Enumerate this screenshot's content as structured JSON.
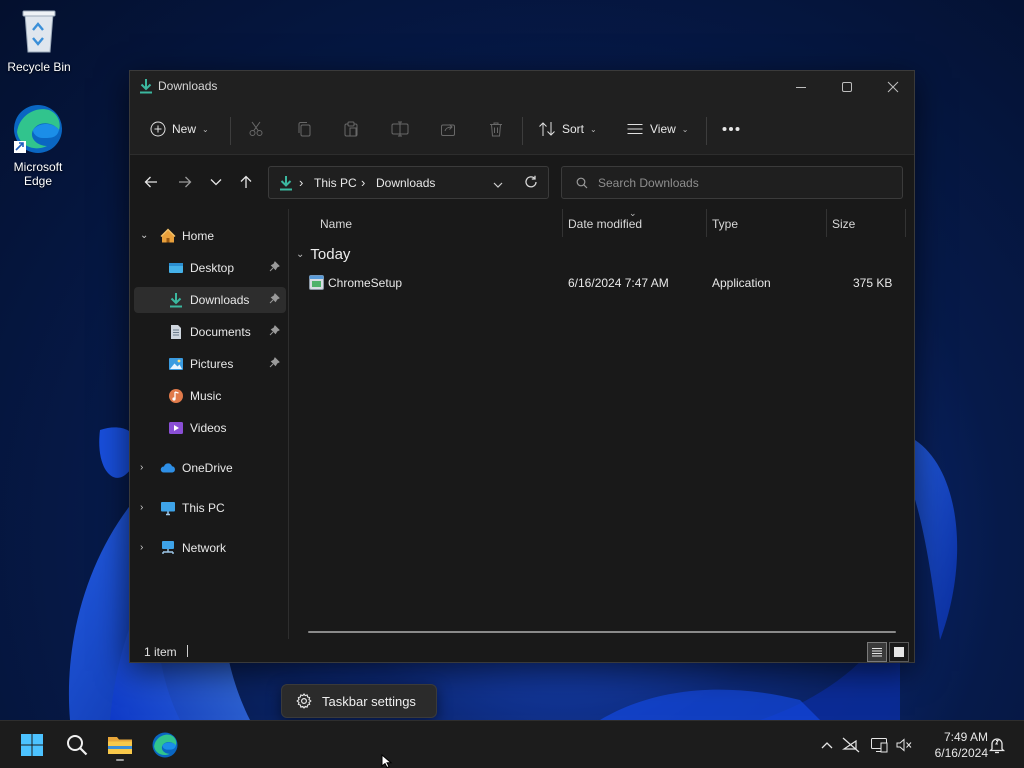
{
  "colors": {
    "accent": "#3bb89f",
    "window_bg": "#191919",
    "chrome_bg": "#202020",
    "taskbar_bg": "#1c1c1c",
    "wallpaper_blue": "#1d4fd8"
  },
  "desktop": {
    "icons": [
      {
        "label": "Recycle Bin",
        "icon": "recycle-bin-icon"
      },
      {
        "label": "Microsoft Edge",
        "icon": "edge-icon"
      }
    ]
  },
  "window": {
    "title": "Downloads",
    "controls": {
      "minimize": "minimize-icon",
      "maximize": "maximize-icon",
      "close": "close-icon"
    }
  },
  "commandbar": {
    "new_label": "New",
    "sort_label": "Sort",
    "view_label": "View",
    "disabled_actions": [
      "cut-icon",
      "copy-icon",
      "paste-icon",
      "rename-icon",
      "share-icon",
      "delete-icon"
    ]
  },
  "navigation": {
    "breadcrumb": [
      "This PC",
      "Downloads"
    ],
    "search_placeholder": "Search Downloads"
  },
  "sidebar": {
    "home": {
      "label": "Home",
      "expanded": true
    },
    "quick_access": [
      {
        "label": "Desktop",
        "icon": "desktop-folder-icon",
        "pinned": true
      },
      {
        "label": "Downloads",
        "icon": "downloads-folder-icon",
        "pinned": true,
        "selected": true
      },
      {
        "label": "Documents",
        "icon": "documents-folder-icon",
        "pinned": true
      },
      {
        "label": "Pictures",
        "icon": "pictures-folder-icon",
        "pinned": true
      },
      {
        "label": "Music",
        "icon": "music-folder-icon",
        "pinned": false
      },
      {
        "label": "Videos",
        "icon": "videos-folder-icon",
        "pinned": false
      }
    ],
    "roots": [
      {
        "label": "OneDrive",
        "icon": "onedrive-icon"
      },
      {
        "label": "This PC",
        "icon": "this-pc-icon"
      },
      {
        "label": "Network",
        "icon": "network-icon"
      }
    ]
  },
  "filelist": {
    "columns": [
      "Name",
      "Date modified",
      "Type",
      "Size"
    ],
    "sorted_column": "Date modified",
    "groups": [
      {
        "label": "Today",
        "rows": [
          {
            "name": "ChromeSetup",
            "date_modified": "6/16/2024 7:47 AM",
            "type": "Application",
            "size": "375 KB",
            "icon": "application-icon"
          }
        ]
      }
    ]
  },
  "statusbar": {
    "item_count": "1 item",
    "view_modes": [
      "details-view-icon",
      "tiles-view-icon"
    ],
    "active_view": "details-view-icon"
  },
  "popup": {
    "taskbar_settings_label": "Taskbar settings"
  },
  "taskbar": {
    "pinned": [
      "start-icon",
      "search-icon",
      "file-explorer-icon",
      "edge-icon"
    ],
    "running": [
      "file-explorer-icon"
    ],
    "tray": [
      "chevron-up-icon",
      "network-disconnected-icon",
      "display-icon",
      "volume-muted-icon",
      "notification-icon"
    ],
    "time": "7:49 AM",
    "date": "6/16/2024"
  }
}
